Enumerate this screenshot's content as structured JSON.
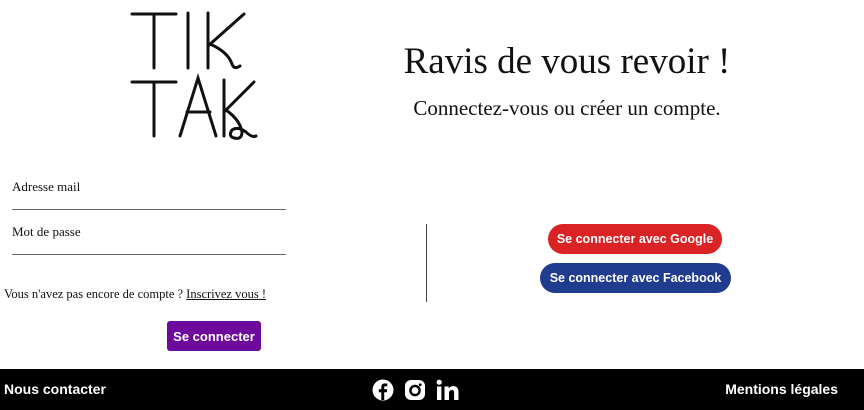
{
  "logo": {
    "line1": "TIK",
    "line2": "TAK"
  },
  "welcome": {
    "title": "Ravis de vous revoir !",
    "subtitle": "Connectez-vous ou créer un compte."
  },
  "form": {
    "email_placeholder": "Adresse mail",
    "password_placeholder": "Mot de passe",
    "no_account_text": "Vous n'avez pas encore de compte ? ",
    "signup_link": "Inscrivez vous !",
    "login_button": "Se connecter",
    "login_button_color": "#6d0a9c"
  },
  "social_login": {
    "google_button": "Se connecter avec Google",
    "google_color": "#d92325",
    "facebook_button": "Se connecter avec Facebook",
    "facebook_color": "#1f3c8f"
  },
  "footer": {
    "contact": "Nous contacter",
    "legal": "Mentions légales",
    "social_icons": [
      "facebook-icon",
      "instagram-icon",
      "linkedin-icon"
    ]
  }
}
